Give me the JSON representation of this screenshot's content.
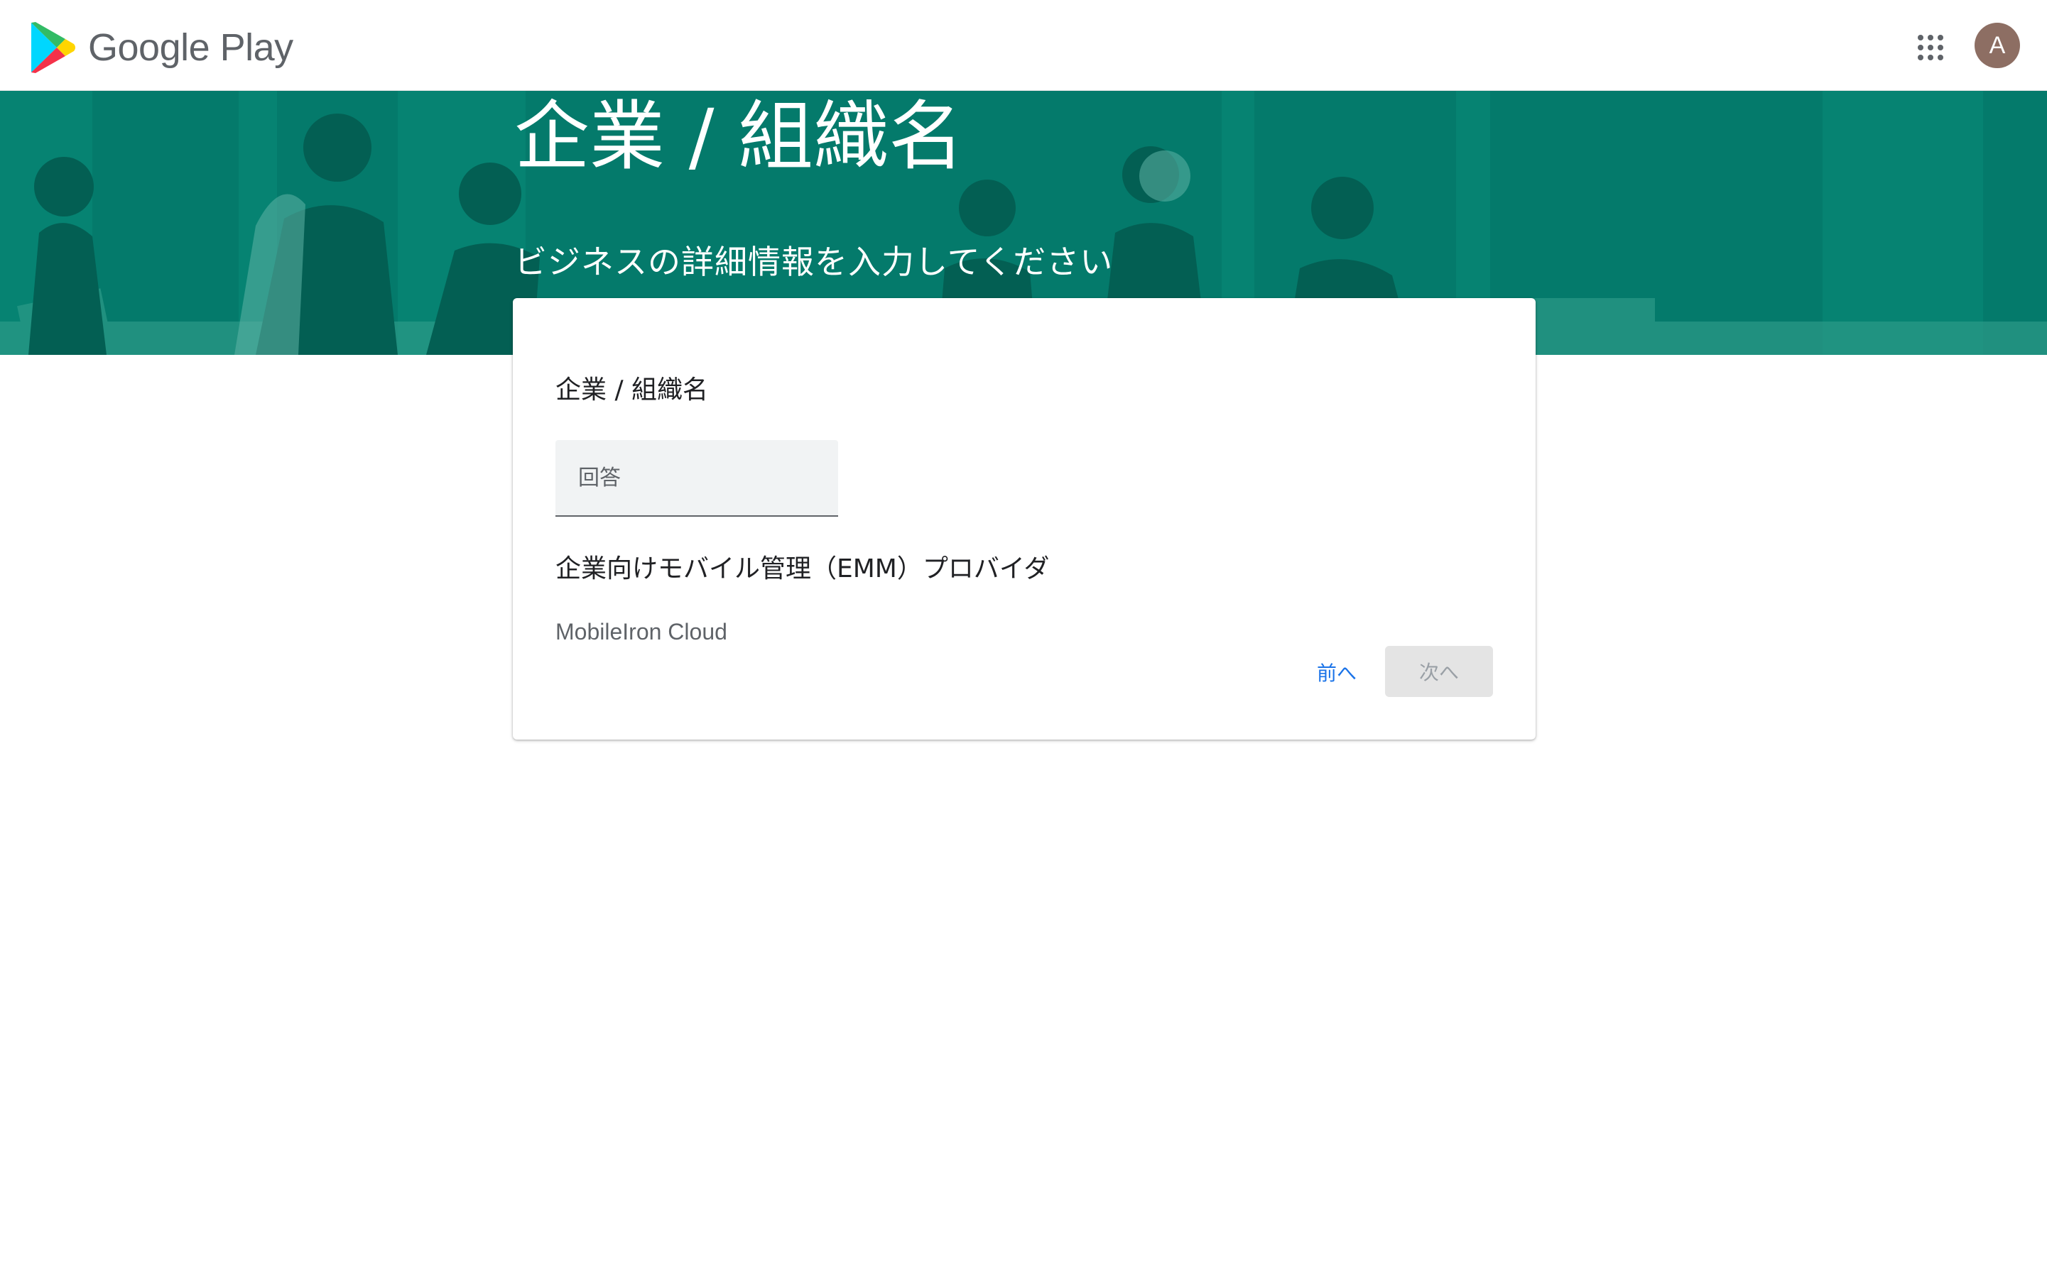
{
  "header": {
    "brand": "Google Play",
    "apps_icon": "apps-grid-icon",
    "avatar_initial": "A",
    "avatar_color": "#8d6e63"
  },
  "banner": {
    "title": "企業 / 組織名",
    "subtitle": "ビジネスの詳細情報を入力してください",
    "background_color": "#047a6b"
  },
  "form": {
    "question1": {
      "label": "企業 / 組織名",
      "placeholder": "回答",
      "value": ""
    },
    "question2": {
      "label": "企業向けモバイル管理（EMM）プロバイダ",
      "value": "MobileIron Cloud"
    },
    "buttons": {
      "prev": "前へ",
      "next": "次へ"
    }
  },
  "colors": {
    "link_blue": "#1a73e8",
    "disabled_button_bg": "#e4e4e4",
    "disabled_button_text": "#9aa0a6"
  }
}
